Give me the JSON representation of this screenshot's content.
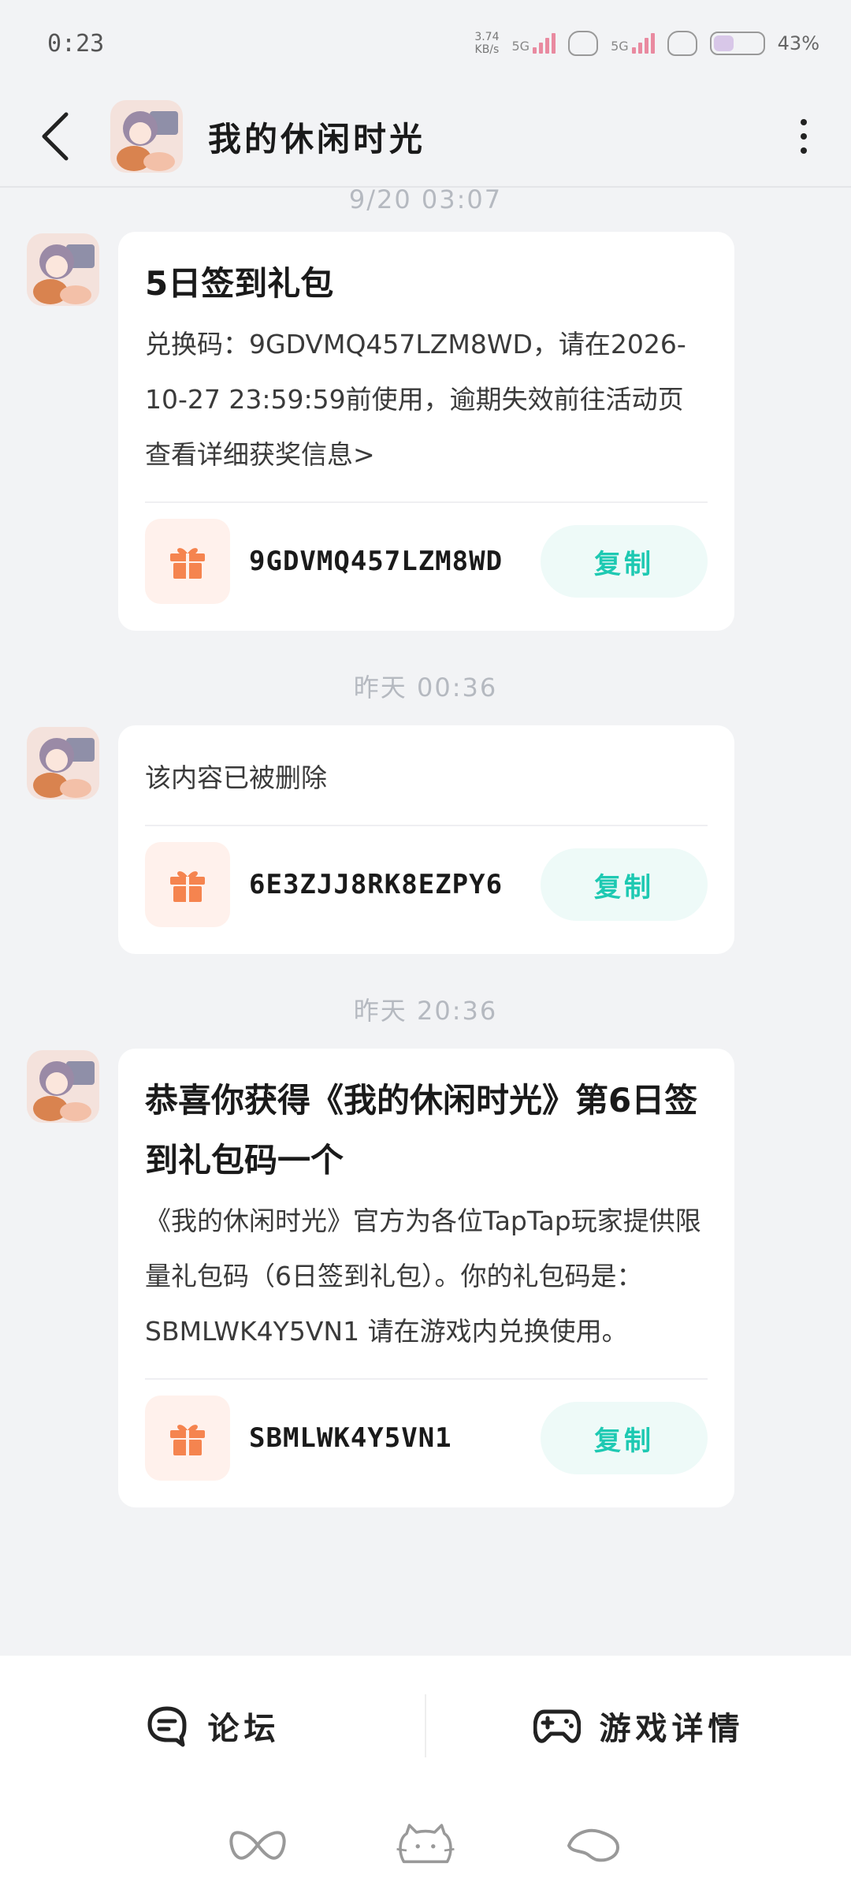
{
  "status_bar": {
    "time": "0:23",
    "net_speed_value": "3.74",
    "net_speed_unit": "KB/s",
    "signal_1": "5G",
    "signal_2": "5G",
    "battery": "43%"
  },
  "header": {
    "title": "我的休闲时光"
  },
  "messages": [
    {
      "timestamp": "9/20  03:07",
      "title": "5日签到礼包",
      "body": "兑换码：9GDVMQ457LZM8WD，请在2026-10-27 23:59:59前使用，逾期失效前往活动页查看详细获奖信息>",
      "code": "9GDVMQ457LZM8WD",
      "copy_label": "复制"
    },
    {
      "timestamp": "昨天  00:36",
      "title": "",
      "body": "该内容已被删除",
      "code": "6E3ZJJ8RK8EZPY6",
      "copy_label": "复制"
    },
    {
      "timestamp": "昨天  20:36",
      "title": "恭喜你获得《我的休闲时光》第6日签到礼包码一个",
      "body": "《我的休闲时光》官方为各位TapTap玩家提供限量礼包码（6日签到礼包）。你的礼包码是：SBMLWK4Y5VN1 请在游戏内兑换使用。",
      "code": "SBMLWK4Y5VN1",
      "copy_label": "复制"
    }
  ],
  "bottom_tabs": {
    "forum_label": "论坛",
    "game_details_label": "游戏详情"
  },
  "colors": {
    "accent_copy": "#1ec9b2",
    "gift_orange": "#f5844f",
    "background": "#f2f3f5"
  }
}
